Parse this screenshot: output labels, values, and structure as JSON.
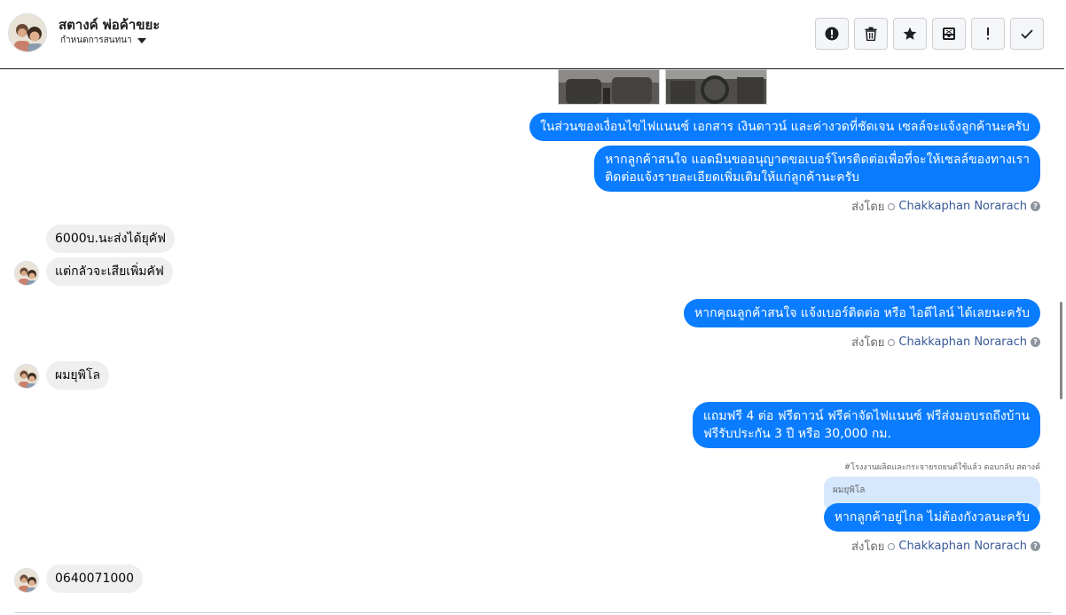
{
  "header": {
    "contact_name": "สตางค์ พ่อค้าขยะ",
    "assign_label": "กำหนดการสนทนา",
    "toolbar": [
      {
        "name": "report-spam-button",
        "icon": "alert-circle-icon"
      },
      {
        "name": "delete-button",
        "icon": "trash-icon"
      },
      {
        "name": "star-button",
        "icon": "star-icon"
      },
      {
        "name": "archive-button",
        "icon": "archive-icon"
      },
      {
        "name": "mark-important-button",
        "icon": "exclamation-icon"
      },
      {
        "name": "mark-done-button",
        "icon": "check-icon"
      }
    ]
  },
  "messages": {
    "out1": "ในส่วนของเงื่อนไขไฟแนนซ์ เอกสาร เงินดาวน์ และค่างวดที่ชัดเจน เซลล์จะแจ้งลูกค้านะครับ",
    "out2_line1": "หากลูกค้าสนใจ แอดมินขออนุญาตขอเบอร์โทรติดต่อเพื่อที่จะให้เซลล์ของทางเรา",
    "out2_line2": "ติดต่อแจ้งรายละเอียดเพิ่มเติมให้แก่ลูกค้านะครับ",
    "in1": "6000บ.นะส่งได้ยุคัฟ",
    "in2": "แต่กลัวจะเสียเพิ่มคัฟ",
    "out3": "หากคุณลูกค้าสนใจ แจ้งเบอร์ติดต่อ หรือ ไอดีไลน์ ได้เลยนะครับ",
    "in3": "ผมยุพิโล",
    "out4_line1": "แถมฟรี 4 ต่อ ฟรีดาวน์ ฟรีค่าจัดไฟแนนซ์ ฟรีส่งมอบรถถึงบ้าน",
    "out4_line2": "ฟรีรับประกัน 3 ปี หรือ 30,000 กม.",
    "reply_note": "#โรงงานผลิตและกระจายรถยนต์ใช้แล้ว ตอบกลับ สตางค์",
    "quoted": "ผมยุพิโล",
    "out5": "หากลูกค้าอยู่ไกล ไม่ต้องกังวลนะครับ",
    "in4": "0640071000"
  },
  "sent_by": {
    "label": "ส่งโดย",
    "name": "Chakkaphan Norarach"
  },
  "colors": {
    "outgoing_bubble": "#0a7cff",
    "incoming_bubble": "#efefef",
    "quoted_bubble": "#d6e8fd",
    "sender_link": "#385898"
  }
}
